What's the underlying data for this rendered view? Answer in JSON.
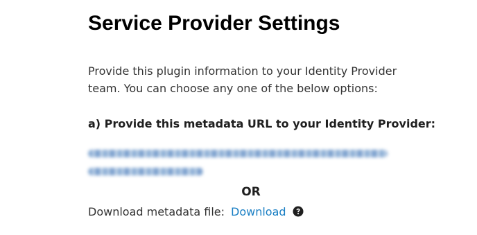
{
  "page": {
    "title": "Service Provider Settings",
    "intro": "Provide this plugin information to your Identity Provider team. You can choose any one of the below options:"
  },
  "option_a": {
    "heading": "a) Provide this metadata URL to your Identity Provider:"
  },
  "separator": {
    "or": "OR"
  },
  "download": {
    "label": "Download metadata file:",
    "link_text": "Download",
    "help_icon": "question-circle-icon"
  },
  "colors": {
    "link": "#1a7fc4",
    "title": "#000000",
    "text": "#333333"
  }
}
